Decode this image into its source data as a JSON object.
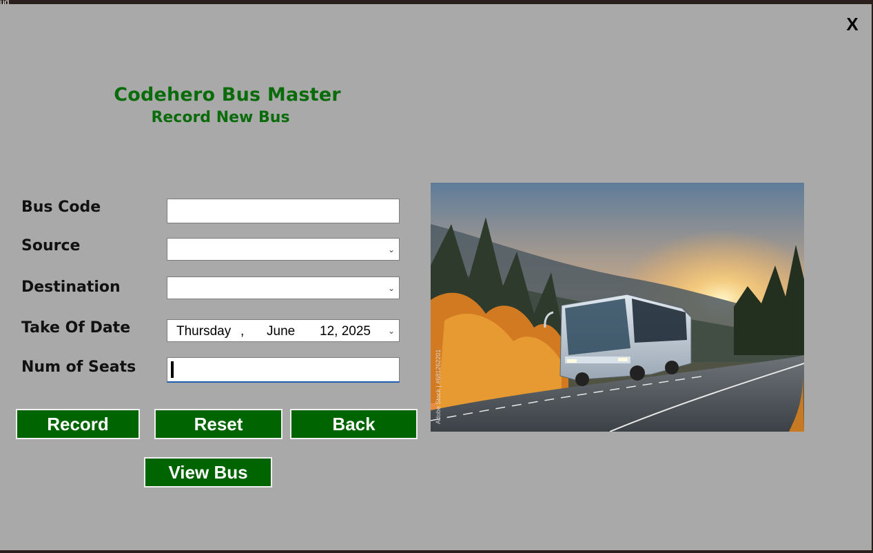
{
  "background": {
    "corner_text": "ud"
  },
  "window": {
    "close_label": "X",
    "title": "Codehero Bus Master",
    "subtitle": "Record New Bus"
  },
  "form": {
    "bus_code": {
      "label": "Bus Code",
      "value": ""
    },
    "source": {
      "label": "Source",
      "value": ""
    },
    "destination": {
      "label": "Destination",
      "value": ""
    },
    "take_off_date": {
      "label": "Take Of Date",
      "weekday": "Thursday",
      "separator": ",",
      "month": "June",
      "day_year": "12, 2025"
    },
    "num_seats": {
      "label": "Num of Seats",
      "value": ""
    }
  },
  "buttons": {
    "record": "Record",
    "reset": "Reset",
    "back": "Back",
    "view_bus": "View Bus"
  },
  "colors": {
    "accent_green": "#006400",
    "title_green": "#0a6b0a",
    "window_gray": "#a9a9a9"
  },
  "image": {
    "watermark": "Adobe Stock | #681262201"
  }
}
